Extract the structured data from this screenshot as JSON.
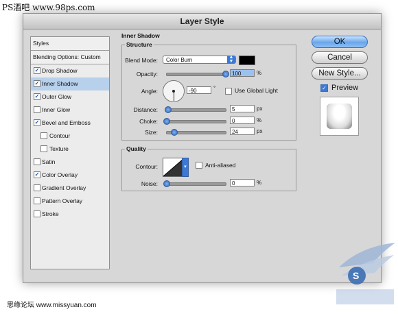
{
  "watermark": {
    "top": "PS酒吧 www.98ps.com",
    "bottom": "思缘论坛  www.missyuan.com"
  },
  "window": {
    "title": "Layer Style"
  },
  "styles_panel": {
    "header": "Styles",
    "blending_options": "Blending Options: Custom",
    "items": [
      {
        "label": "Drop Shadow",
        "checked": true,
        "sub": false,
        "selected": false
      },
      {
        "label": "Inner Shadow",
        "checked": true,
        "sub": false,
        "selected": true
      },
      {
        "label": "Outer Glow",
        "checked": true,
        "sub": false,
        "selected": false
      },
      {
        "label": "Inner Glow",
        "checked": false,
        "sub": false,
        "selected": false
      },
      {
        "label": "Bevel and Emboss",
        "checked": true,
        "sub": false,
        "selected": false
      },
      {
        "label": "Contour",
        "checked": false,
        "sub": true,
        "selected": false
      },
      {
        "label": "Texture",
        "checked": false,
        "sub": true,
        "selected": false
      },
      {
        "label": "Satin",
        "checked": false,
        "sub": false,
        "selected": false
      },
      {
        "label": "Color Overlay",
        "checked": true,
        "sub": false,
        "selected": false
      },
      {
        "label": "Gradient Overlay",
        "checked": false,
        "sub": false,
        "selected": false
      },
      {
        "label": "Pattern Overlay",
        "checked": false,
        "sub": false,
        "selected": false
      },
      {
        "label": "Stroke",
        "checked": false,
        "sub": false,
        "selected": false
      }
    ]
  },
  "inner_shadow": {
    "title": "Inner Shadow",
    "structure": {
      "title": "Structure",
      "blend_mode_label": "Blend Mode:",
      "blend_mode_value": "Color Burn",
      "blend_color": "#000000",
      "opacity_label": "Opacity:",
      "opacity_value": "100",
      "opacity_unit": "%",
      "angle_label": "Angle:",
      "angle_value": "-90",
      "angle_unit": "°",
      "global_light_label": "Use Global Light",
      "global_light_checked": false,
      "distance_label": "Distance:",
      "distance_value": "5",
      "distance_unit": "px",
      "choke_label": "Choke:",
      "choke_value": "0",
      "choke_unit": "%",
      "size_label": "Size:",
      "size_value": "24",
      "size_unit": "px"
    },
    "quality": {
      "title": "Quality",
      "contour_label": "Contour:",
      "anti_aliased_label": "Anti-aliased",
      "anti_aliased_checked": false,
      "noise_label": "Noise:",
      "noise_value": "0",
      "noise_unit": "%"
    }
  },
  "buttons": {
    "ok": "OK",
    "cancel": "Cancel",
    "new_style": "New Style...",
    "preview_label": "Preview",
    "preview_checked": true
  },
  "colors": {
    "accent": "#3c78d6",
    "selection": "#b7d0ec",
    "dialog_bg": "#d7d7d7"
  }
}
